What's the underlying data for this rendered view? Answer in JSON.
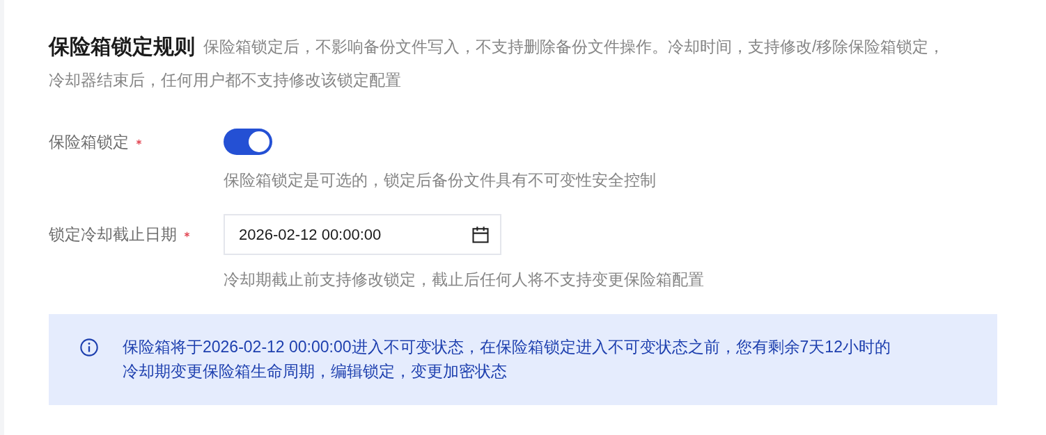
{
  "section": {
    "title": "保险箱锁定规则",
    "description_lines": [
      "保险箱锁定后，不影响备份文件写入，不支持删除备份文件操作。冷却时间，支持修改/移除保险箱锁定，",
      "冷却器结束后，任何用户都不支持修改该锁定配置"
    ]
  },
  "fields": [
    {
      "kind": "switch",
      "label": "保险箱锁定",
      "required": true,
      "on": true,
      "hint": "保险箱锁定是可选的，锁定后备份文件具有不可变性安全控制"
    },
    {
      "kind": "date",
      "label": "锁定冷却截止日期",
      "required": true,
      "value": "2026-02-12 00:00:00",
      "hint": "冷却期截止前支持修改锁定，截止后任何人将不支持变更保险箱配置"
    }
  ],
  "notice": {
    "text": "保险箱将于2026-02-12 00:00:00进入不可变状态，在保险箱锁定进入不可变状态之前，您有剩余7天12小时的冷却期变更保险箱生命周期，编辑锁定，变更加密状态"
  }
}
